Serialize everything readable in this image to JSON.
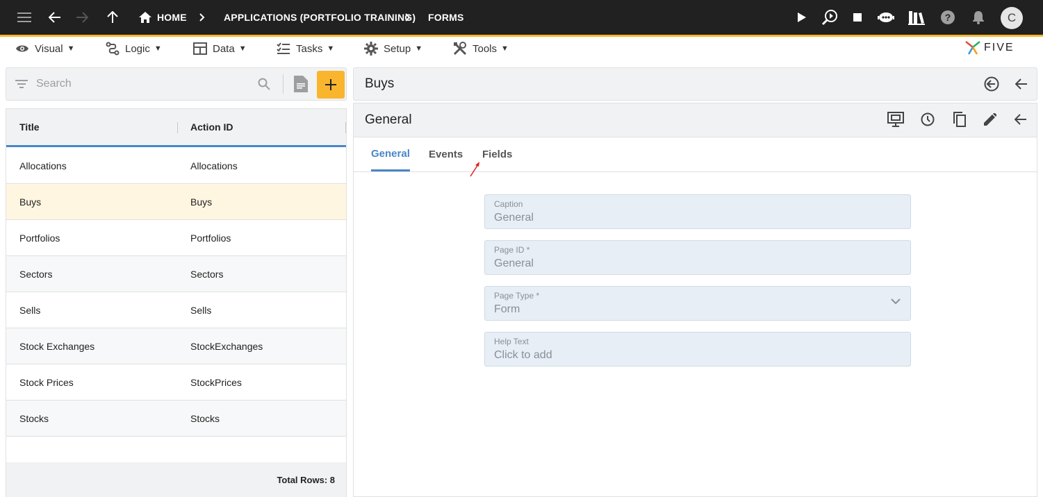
{
  "breadcrumbs": {
    "home": "HOME",
    "application": "APPLICATIONS (PORTFOLIO TRAINING)",
    "current": "FORMS"
  },
  "user": {
    "avatar_letter": "C"
  },
  "toolbar": {
    "menus": [
      {
        "label": "Visual",
        "icon": "eye-icon"
      },
      {
        "label": "Logic",
        "icon": "logic-icon"
      },
      {
        "label": "Data",
        "icon": "table-icon"
      },
      {
        "label": "Tasks",
        "icon": "tasks-icon"
      },
      {
        "label": "Setup",
        "icon": "gear-icon"
      },
      {
        "label": "Tools",
        "icon": "tools-icon"
      }
    ],
    "caret": "▼"
  },
  "brand": {
    "name": "FIVE"
  },
  "search": {
    "placeholder": "Search"
  },
  "list": {
    "columns": [
      "Title",
      "Action ID"
    ],
    "rows": [
      {
        "title": "Allocations",
        "action_id": "Allocations"
      },
      {
        "title": "Buys",
        "action_id": "Buys"
      },
      {
        "title": "Portfolios",
        "action_id": "Portfolios"
      },
      {
        "title": "Sectors",
        "action_id": "Sectors"
      },
      {
        "title": "Sells",
        "action_id": "Sells"
      },
      {
        "title": "Stock Exchanges",
        "action_id": "StockExchanges"
      },
      {
        "title": "Stock Prices",
        "action_id": "StockPrices"
      },
      {
        "title": "Stocks",
        "action_id": "Stocks"
      }
    ],
    "selected_index": 1,
    "footer": "Total Rows: 8"
  },
  "record": {
    "title": "Buys"
  },
  "form": {
    "title": "General",
    "tabs": [
      "General",
      "Events",
      "Fields"
    ],
    "active_tab": 0,
    "fields": [
      {
        "label": "Caption",
        "value": "General"
      },
      {
        "label": "Page ID *",
        "value": "General"
      },
      {
        "label": "Page Type *",
        "value": "Form",
        "dropdown": true
      },
      {
        "label": "Help Text",
        "value": "Click to add"
      }
    ]
  },
  "colors": {
    "appbar": "#212121",
    "accent": "#f9b52d",
    "active_tab": "#4a86c8",
    "selected_row": "#fff6e1"
  }
}
